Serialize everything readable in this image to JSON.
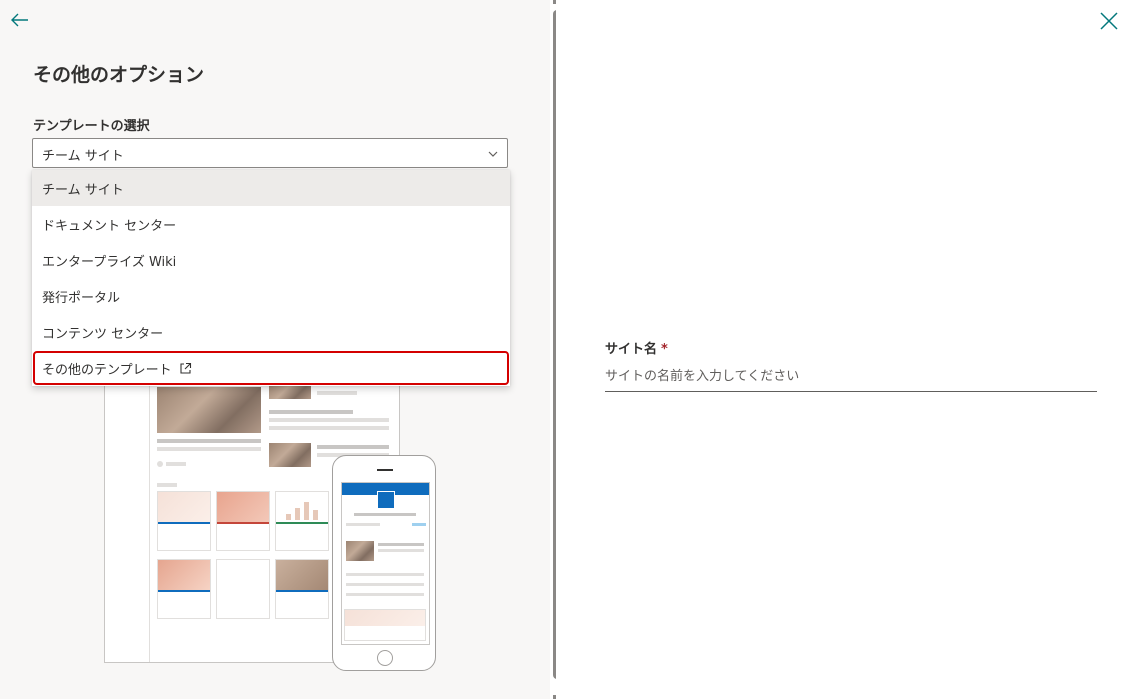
{
  "panel": {
    "title": "その他のオプション"
  },
  "template_select": {
    "label": "テンプレートの選択",
    "selected": "チーム サイト",
    "options": [
      {
        "label": "チーム サイト"
      },
      {
        "label": "ドキュメント センター"
      },
      {
        "label": "エンタープライズ Wiki"
      },
      {
        "label": "発行ポータル"
      },
      {
        "label": "コンテンツ センター"
      },
      {
        "label": "その他のテンプレート"
      }
    ]
  },
  "site_name": {
    "label": "サイト名",
    "required_mark": "*",
    "placeholder": "サイトの名前を入力してください",
    "value": ""
  },
  "icons": {
    "back": "arrow-left-icon",
    "close": "close-icon",
    "chevron": "chevron-down-icon",
    "external": "external-link-icon"
  },
  "colors": {
    "accent": "#0f6cbd",
    "highlight_outline": "#d40000",
    "required": "#a4262c"
  }
}
